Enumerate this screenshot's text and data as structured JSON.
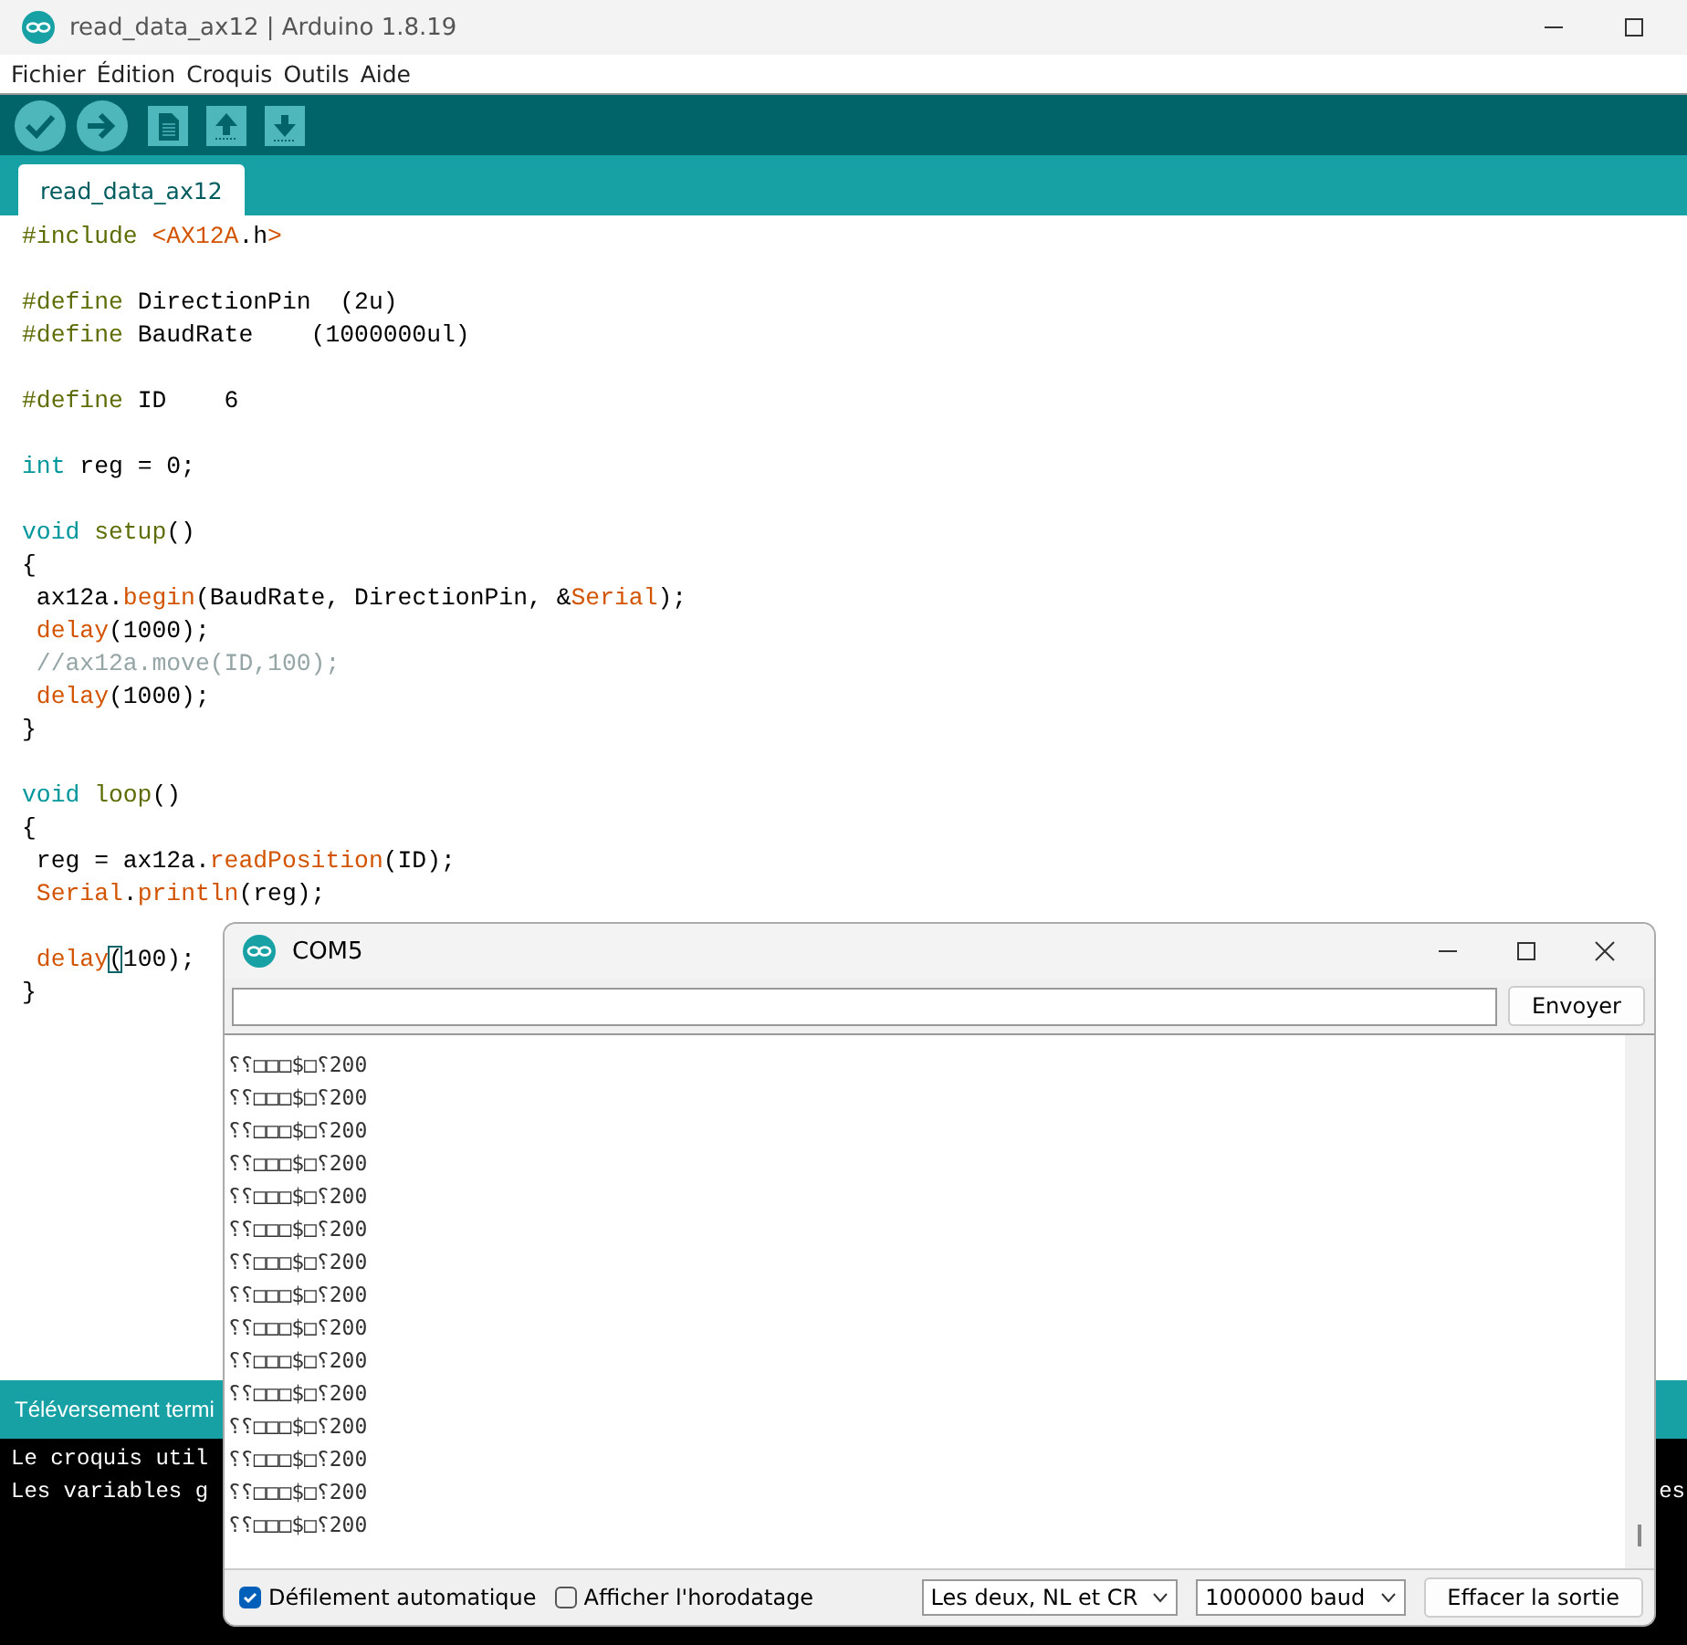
{
  "window": {
    "title": "read_data_ax12 | Arduino 1.8.19"
  },
  "menu": [
    "Fichier",
    "Édition",
    "Croquis",
    "Outils",
    "Aide"
  ],
  "toolbar": [
    {
      "kind": "verify"
    },
    {
      "kind": "upload"
    },
    {
      "kind": "new"
    },
    {
      "kind": "open"
    },
    {
      "kind": "save"
    }
  ],
  "tabs": [
    {
      "label": "read_data_ax12",
      "selected": true
    }
  ],
  "code": [
    {
      "space_before": false,
      "tokens": [
        {
          "text": "#include",
          "kind": "directive"
        },
        {
          "text": " <AX12A",
          "kind": "lib"
        },
        {
          "text": ".h",
          "kind": "plain"
        },
        {
          "text": ">",
          "kind": "lib"
        }
      ]
    },
    {
      "space_before": true,
      "tokens": [
        {
          "text": "#define",
          "kind": "directive"
        },
        {
          "text": " DirectionPin  (2u)",
          "kind": "plain"
        }
      ]
    },
    {
      "space_before": false,
      "tokens": [
        {
          "text": "#define",
          "kind": "directive"
        },
        {
          "text": " BaudRate    (1000000ul)",
          "kind": "plain"
        }
      ]
    },
    {
      "space_before": true,
      "tokens": [
        {
          "text": "#define",
          "kind": "directive"
        },
        {
          "text": " ID    6",
          "kind": "plain"
        }
      ]
    },
    {
      "space_before": true,
      "tokens": [
        {
          "text": "int",
          "kind": "type"
        },
        {
          "text": " reg = 0;",
          "kind": "plain"
        }
      ]
    },
    {
      "space_before": true,
      "tokens": [
        {
          "text": "void",
          "kind": "type"
        },
        {
          "text": " setup",
          "kind": "func"
        },
        {
          "text": "()",
          "kind": "plain"
        }
      ]
    },
    {
      "space_before": false,
      "tokens": [
        {
          "text": "{",
          "kind": "plain"
        }
      ]
    },
    {
      "space_before": false,
      "tokens": [
        {
          "text": " ax12a.",
          "kind": "plain"
        },
        {
          "text": "begin",
          "kind": "call"
        },
        {
          "text": "(BaudRate, DirectionPin, &",
          "kind": "plain"
        },
        {
          "text": "Serial",
          "kind": "call"
        },
        {
          "text": ");",
          "kind": "plain"
        }
      ]
    },
    {
      "space_before": false,
      "tokens": [
        {
          "text": " delay",
          "kind": "call"
        },
        {
          "text": "(1000);",
          "kind": "plain"
        }
      ]
    },
    {
      "space_before": false,
      "tokens": [
        {
          "text": " //ax12a.move(ID,100);",
          "kind": "comment"
        }
      ]
    },
    {
      "space_before": false,
      "tokens": [
        {
          "text": " delay",
          "kind": "call"
        },
        {
          "text": "(1000);",
          "kind": "plain"
        }
      ]
    },
    {
      "space_before": false,
      "tokens": [
        {
          "text": "}",
          "kind": "plain"
        }
      ]
    },
    {
      "space_before": true,
      "tokens": [
        {
          "text": "void",
          "kind": "type"
        },
        {
          "text": " loop",
          "kind": "func"
        },
        {
          "text": "()",
          "kind": "plain"
        }
      ]
    },
    {
      "space_before": false,
      "tokens": [
        {
          "text": "{",
          "kind": "plain"
        }
      ]
    },
    {
      "space_before": false,
      "tokens": [
        {
          "text": " reg = ax12a.",
          "kind": "plain"
        },
        {
          "text": "readPosition",
          "kind": "call"
        },
        {
          "text": "(ID);",
          "kind": "plain"
        }
      ]
    },
    {
      "space_before": false,
      "tokens": [
        {
          "text": " Serial",
          "kind": "call"
        },
        {
          "text": ".",
          "kind": "plain"
        },
        {
          "text": "println",
          "kind": "call"
        },
        {
          "text": "(reg);",
          "kind": "plain"
        }
      ]
    },
    {
      "space_before": true,
      "tokens": [
        {
          "text": " delay",
          "kind": "call"
        },
        {
          "text": "(",
          "kind": "match"
        },
        {
          "text": "100);",
          "kind": "plain"
        }
      ]
    },
    {
      "space_before": false,
      "tokens": [
        {
          "text": "}",
          "kind": "plain"
        }
      ]
    }
  ],
  "status": "Téléversement termi",
  "console": [
    {
      "text": "Le croquis util"
    },
    {
      "text": "Les variables g",
      "tail": "es"
    }
  ],
  "serial_monitor": {
    "title": "COM5",
    "send_button": "Envoyer",
    "output": [
      "⸮⸮□□□$□⸮200",
      "⸮⸮□□□$□⸮200",
      "⸮⸮□□□$□⸮200",
      "⸮⸮□□□$□⸮200",
      "⸮⸮□□□$□⸮200",
      "⸮⸮□□□$□⸮200",
      "⸮⸮□□□$□⸮200",
      "⸮⸮□□□$□⸮200",
      "⸮⸮□□□$□⸮200",
      "⸮⸮□□□$□⸮200",
      "⸮⸮□□□$□⸮200",
      "⸮⸮□□□$□⸮200",
      "⸮⸮□□□$□⸮200",
      "⸮⸮□□□$□⸮200",
      "⸮⸮□□□$□⸮200"
    ],
    "autoscroll": {
      "label": "Défilement automatique",
      "checked": true
    },
    "timestamp": {
      "label": "Afficher l'horodatage",
      "checked": false
    },
    "line_ending": "Les deux, NL et CR",
    "baud": "1000000 baud",
    "clear_button": "Effacer la sortie"
  }
}
